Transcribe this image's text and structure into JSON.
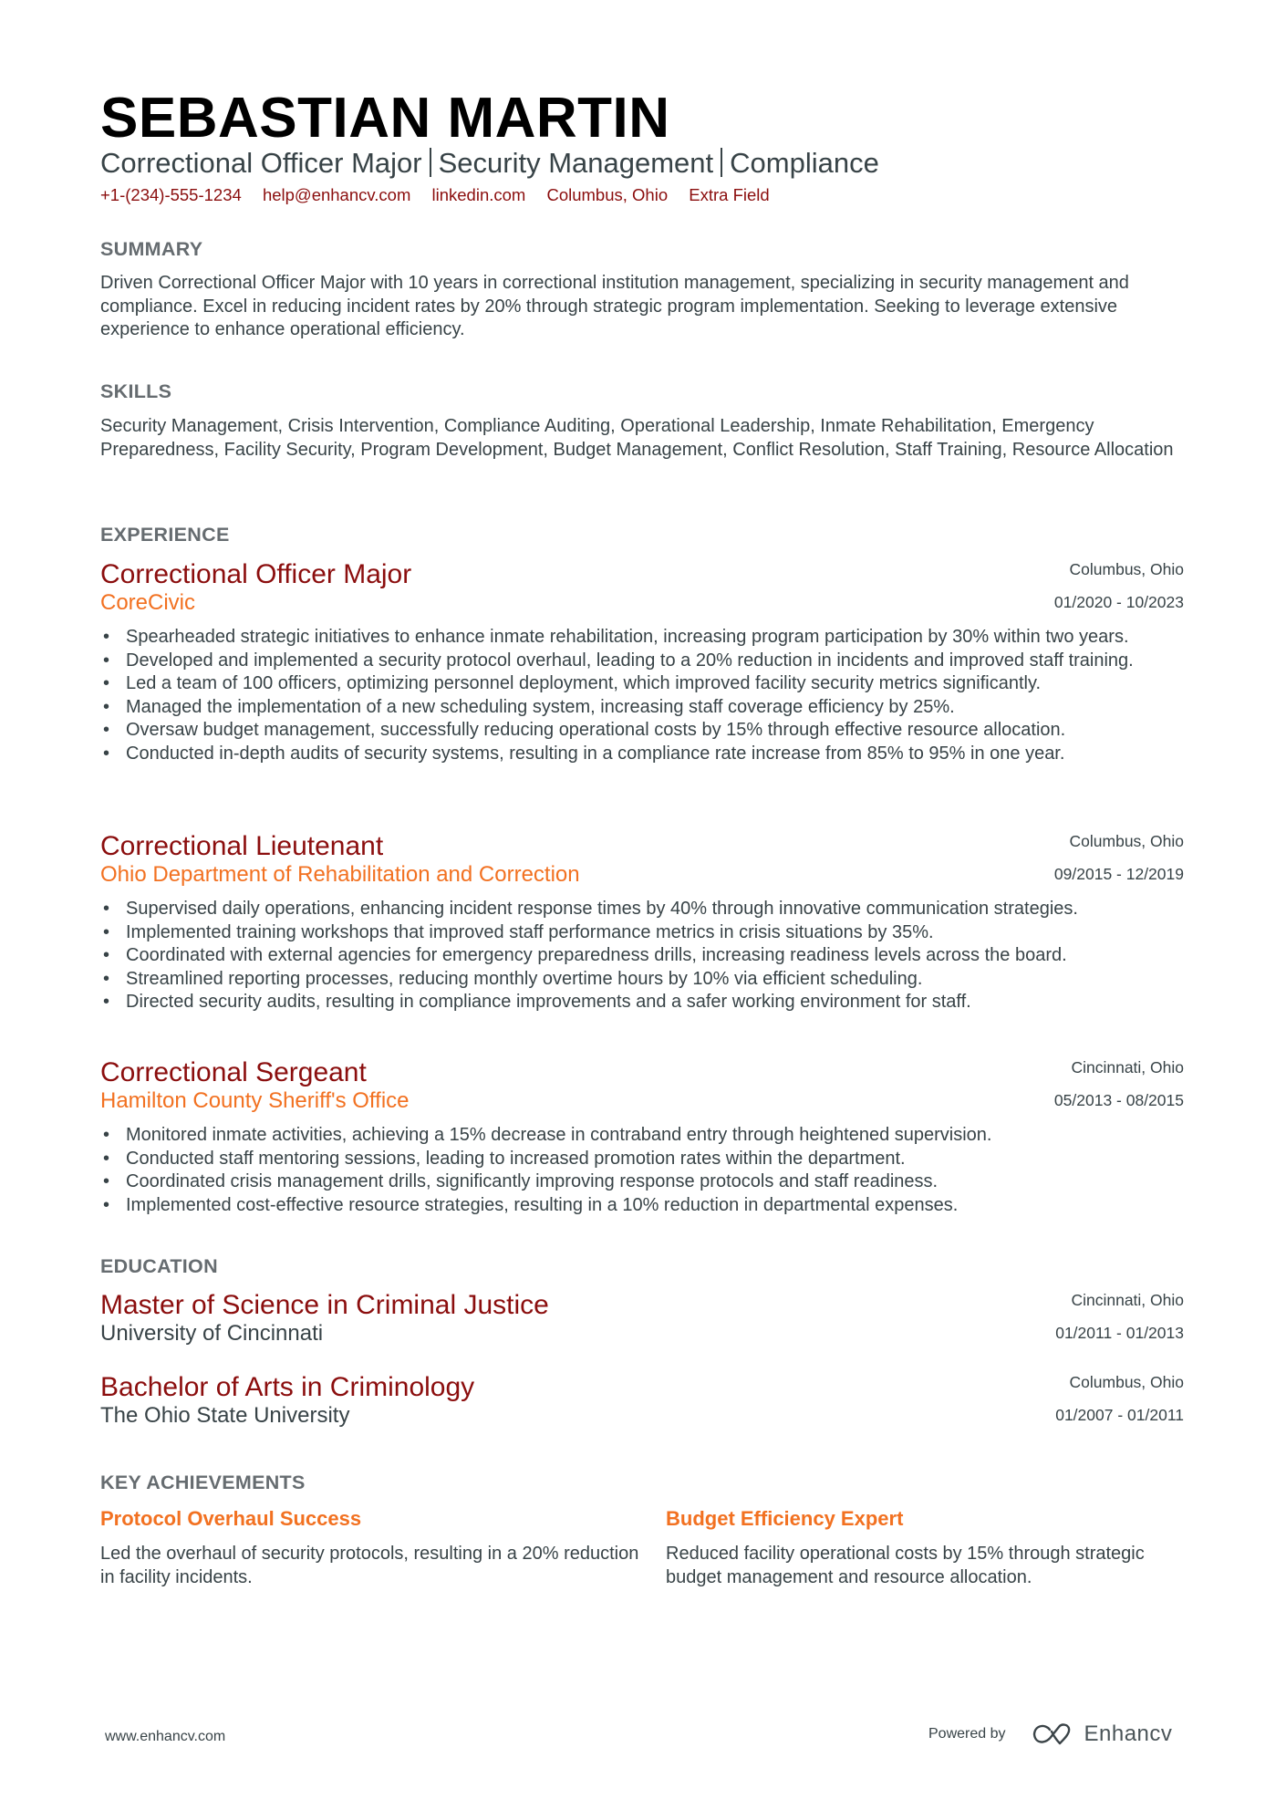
{
  "header": {
    "name": "SEBASTIAN MARTIN",
    "subtitle_parts": [
      "Correctional Officer Major",
      "Security Management",
      "Compliance"
    ],
    "contact": {
      "phone": "+1-(234)-555-1234",
      "email": "help@enhancv.com",
      "linkedin": "linkedin.com",
      "location": "Columbus, Ohio",
      "extra": "Extra Field"
    }
  },
  "colors": {
    "accent_dark_red": "#8b0e0e",
    "accent_orange": "#f27121",
    "text": "#384347",
    "section_heading": "#666c70"
  },
  "summary": {
    "heading": "SUMMARY",
    "text": "Driven Correctional Officer Major with 10 years in correctional institution management, specializing in security management and compliance. Excel in reducing incident rates by 20% through strategic program implementation. Seeking to leverage extensive experience to enhance operational efficiency."
  },
  "skills": {
    "heading": "SKILLS",
    "text": "Security Management, Crisis Intervention, Compliance Auditing, Operational Leadership, Inmate Rehabilitation, Emergency Preparedness, Facility Security, Program Development, Budget Management, Conflict Resolution, Staff Training, Resource Allocation"
  },
  "experience": {
    "heading": "EXPERIENCE",
    "items": [
      {
        "title": "Correctional Officer Major",
        "company": "CoreCivic",
        "location": "Columbus, Ohio",
        "dates": "01/2020 - 10/2023",
        "bullets": [
          "Spearheaded strategic initiatives to enhance inmate rehabilitation, increasing program participation by 30% within two years.",
          "Developed and implemented a security protocol overhaul, leading to a 20% reduction in incidents and improved staff training.",
          "Led a team of 100 officers, optimizing personnel deployment, which improved facility security metrics significantly.",
          "Managed the implementation of a new scheduling system, increasing staff coverage efficiency by 25%.",
          "Oversaw budget management, successfully reducing operational costs by 15% through effective resource allocation.",
          "Conducted in-depth audits of security systems, resulting in a compliance rate increase from 85% to 95% in one year."
        ]
      },
      {
        "title": "Correctional Lieutenant",
        "company": "Ohio Department of Rehabilitation and Correction",
        "location": "Columbus, Ohio",
        "dates": "09/2015 - 12/2019",
        "bullets": [
          "Supervised daily operations, enhancing incident response times by 40% through innovative communication strategies.",
          "Implemented training workshops that improved staff performance metrics in crisis situations by 35%.",
          "Coordinated with external agencies for emergency preparedness drills, increasing readiness levels across the board.",
          "Streamlined reporting processes, reducing monthly overtime hours by 10% via efficient scheduling.",
          "Directed security audits, resulting in compliance improvements and a safer working environment for staff."
        ]
      },
      {
        "title": "Correctional Sergeant",
        "company": "Hamilton County Sheriff's Office",
        "location": "Cincinnati, Ohio",
        "dates": "05/2013 - 08/2015",
        "bullets": [
          "Monitored inmate activities, achieving a 15% decrease in contraband entry through heightened supervision.",
          "Conducted staff mentoring sessions, leading to increased promotion rates within the department.",
          "Coordinated crisis management drills, significantly improving response protocols and staff readiness.",
          "Implemented cost-effective resource strategies, resulting in a 10% reduction in departmental expenses."
        ]
      }
    ]
  },
  "education": {
    "heading": "EDUCATION",
    "items": [
      {
        "degree": "Master of Science in Criminal Justice",
        "school": "University of Cincinnati",
        "location": "Cincinnati, Ohio",
        "dates": "01/2011 - 01/2013"
      },
      {
        "degree": "Bachelor of Arts in Criminology",
        "school": "The Ohio State University",
        "location": "Columbus, Ohio",
        "dates": "01/2007 - 01/2011"
      }
    ]
  },
  "achievements": {
    "heading": "KEY ACHIEVEMENTS",
    "items": [
      {
        "title": "Protocol Overhaul Success",
        "description": "Led the overhaul of security protocols, resulting in a 20% reduction in facility incidents."
      },
      {
        "title": "Budget Efficiency Expert",
        "description": "Reduced facility operational costs by 15% through strategic budget management and resource allocation."
      }
    ]
  },
  "footer": {
    "website": "www.enhancv.com",
    "powered_by": "Powered by",
    "brand": "Enhancv",
    "brand_icon": "enhancv-logo-icon"
  }
}
